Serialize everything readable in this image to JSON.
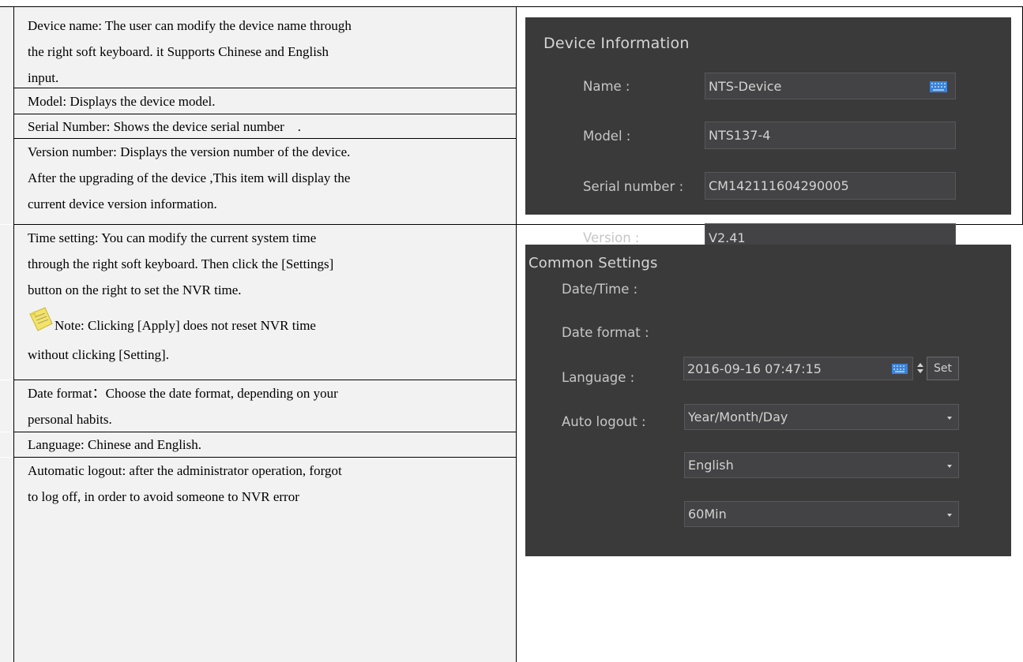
{
  "left_column": {
    "device_name": [
      "Device name: The user can modify the device name through",
      "the right soft keyboard. it Supports Chinese and English",
      "input."
    ],
    "model": "Model: Displays the device model.",
    "serial": "Serial Number: Shows the device serial number    .",
    "version": [
      "Version number: Displays the version number of the device.",
      "After the upgrading of the device ,This item will display the",
      "current device version information."
    ],
    "time_setting": [
      "Time setting: You can modify the current system time",
      "through the right soft keyboard. Then click the [Settings]",
      "button on the right to set the NVR time."
    ],
    "note": [
      "Note: Clicking [Apply] does not reset NVR time",
      "without clicking [Setting]."
    ],
    "date_format": [
      "Date format：Choose the date format, depending on your",
      "personal habits."
    ],
    "language": "Language: Chinese and English.",
    "auto_logout": [
      "Automatic logout: after the administrator operation, forgot",
      "to log off, in order to avoid someone to NVR error"
    ]
  },
  "device_info": {
    "title": "Device Information",
    "name_label": "Name :",
    "name_value": "NTS-Device",
    "model_label": "Model :",
    "model_value": "NTS137-4",
    "serial_label": "Serial number :",
    "serial_value": "CM142111604290005",
    "version_label": "Version :",
    "version_value": "V2.41"
  },
  "common_settings": {
    "title": "Common Settings",
    "datetime_label": "Date/Time :",
    "datetime_value": "2016-09-16 07:47:15",
    "set_button": "Set",
    "date_format_label": "Date format :",
    "date_format_value": "Year/Month/Day",
    "language_label": "Language :",
    "language_value": "English",
    "auto_logout_label": "Auto logout :",
    "auto_logout_value": "60Min"
  },
  "colors": {
    "panel_bg": "#3a3a3b",
    "field_bg": "#434345",
    "keyboard_icon": "#3b82d8",
    "cell_bg": "#f2f2f2"
  },
  "icons": [
    "note-paper-icon",
    "keyboard-icon",
    "dropdown-caret-icon",
    "spinner-icon"
  ]
}
